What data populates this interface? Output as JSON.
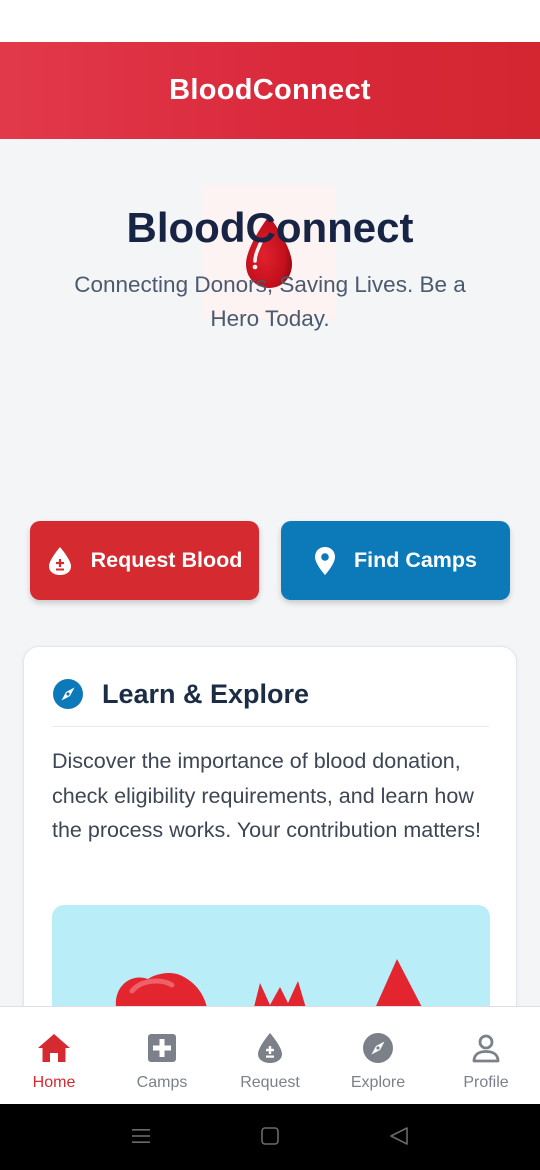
{
  "header": {
    "title": "BloodConnect"
  },
  "hero": {
    "title": "BloodConnect",
    "subtitle": "Connecting Donors, Saving Lives. Be a Hero Today."
  },
  "actions": {
    "request_label": "Request Blood",
    "camps_label": "Find Camps"
  },
  "card": {
    "title": "Learn & Explore",
    "text": "Discover the importance of blood donation, check eligibility requirements, and learn how the process works. Your contribution matters!"
  },
  "bottom_nav": {
    "items": [
      {
        "label": "Home",
        "icon": "home-icon",
        "active": true
      },
      {
        "label": "Camps",
        "icon": "medical-cross-icon",
        "active": false
      },
      {
        "label": "Request",
        "icon": "blood-drop-icon",
        "active": false
      },
      {
        "label": "Explore",
        "icon": "compass-icon",
        "active": false
      },
      {
        "label": "Profile",
        "icon": "person-icon",
        "active": false
      }
    ]
  },
  "colors": {
    "brand_red": "#d42a30",
    "brand_blue": "#0c79b8",
    "header_gradient_start": "#e2394a",
    "header_gradient_end": "#d42631",
    "inactive_nav": "#7b8089"
  }
}
